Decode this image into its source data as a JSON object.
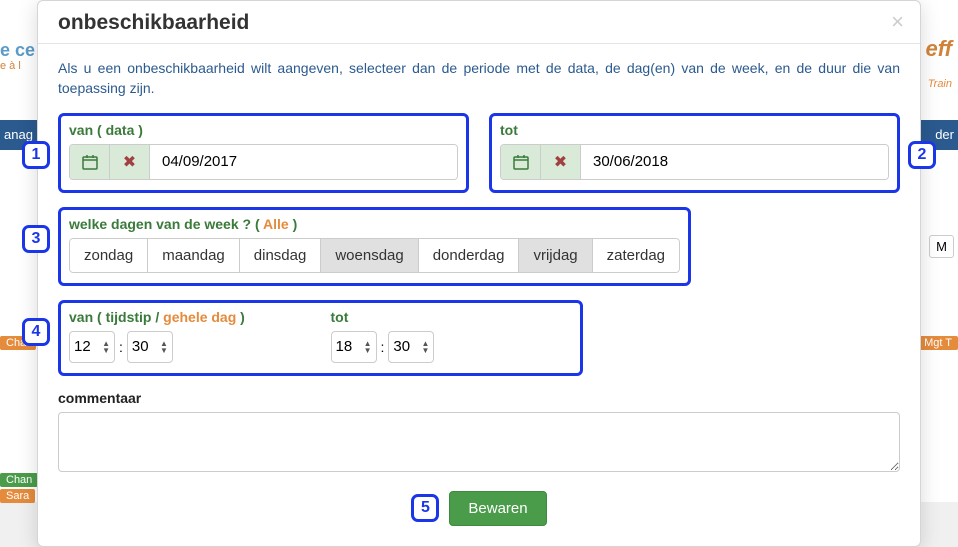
{
  "modal": {
    "title": "onbeschikbaarheid",
    "intro": "Als u een onbeschikbaarheid wilt aangeven, selecteer dan de periode met de data, de dag(en) van de week, en de duur die van toepassing zijn."
  },
  "date_from": {
    "label_prefix": "van ( ",
    "label_part": "data",
    "label_suffix": " )",
    "value": "04/09/2017"
  },
  "date_to": {
    "label": "tot",
    "value": "30/06/2018"
  },
  "days": {
    "label_prefix": "welke dagen van de week ? ( ",
    "label_link": "Alle",
    "label_suffix": " )",
    "items": [
      {
        "label": "zondag",
        "active": false
      },
      {
        "label": "maandag",
        "active": false
      },
      {
        "label": "dinsdag",
        "active": false
      },
      {
        "label": "woensdag",
        "active": true
      },
      {
        "label": "donderdag",
        "active": false
      },
      {
        "label": "vrijdag",
        "active": true
      },
      {
        "label": "zaterdag",
        "active": false
      }
    ]
  },
  "time_from": {
    "label_prefix": "van ( ",
    "label_part1": "tijdstip",
    "label_sep": " / ",
    "label_part2": "gehele dag",
    "label_suffix": " )",
    "hour": "12",
    "minute": "30"
  },
  "time_to": {
    "label": "tot",
    "hour": "18",
    "minute": "30"
  },
  "comment": {
    "label": "commentaar",
    "value": ""
  },
  "buttons": {
    "save": "Bewaren"
  },
  "callouts": {
    "c1": "1",
    "c2": "2",
    "c3": "3",
    "c4": "4",
    "c5": "5"
  },
  "icons": {
    "close": "×",
    "calendar": "📅",
    "clear": "✖",
    "sep": ":"
  },
  "background": {
    "ce": "e ce",
    "sub": "e à l",
    "anag": "anag",
    "der": "der",
    "eff": "eff",
    "train": "Train",
    "m": "M",
    "chan": "Chan",
    "sara": "Sara",
    "mgt": "Mgt T",
    "char": "Char"
  }
}
